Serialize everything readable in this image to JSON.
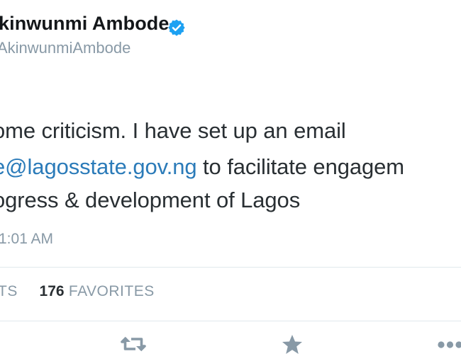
{
  "author": {
    "display_name": "kinwunmi Ambode",
    "handle": "AkinwunmiAmbode",
    "verified": true,
    "verified_color": "#1da1f2"
  },
  "tweet": {
    "line1": "ome criticism. I have set up an email",
    "line2_link": "e@lagosstate.gov.ng",
    "line2_rest": " to facilitate engagem",
    "line3": "ogress & development of Lagos",
    "link_color": "#2b7bb9",
    "timestamp": "1:01 AM"
  },
  "stats": {
    "retweets_label": "TS",
    "favorites_count": "176",
    "favorites_label": "FAVORITES"
  },
  "actions": {
    "retweet_icon": "retweet-icon",
    "favorite_icon": "star-icon",
    "more_icon": "more-icon",
    "icon_color": "#8899a6"
  }
}
